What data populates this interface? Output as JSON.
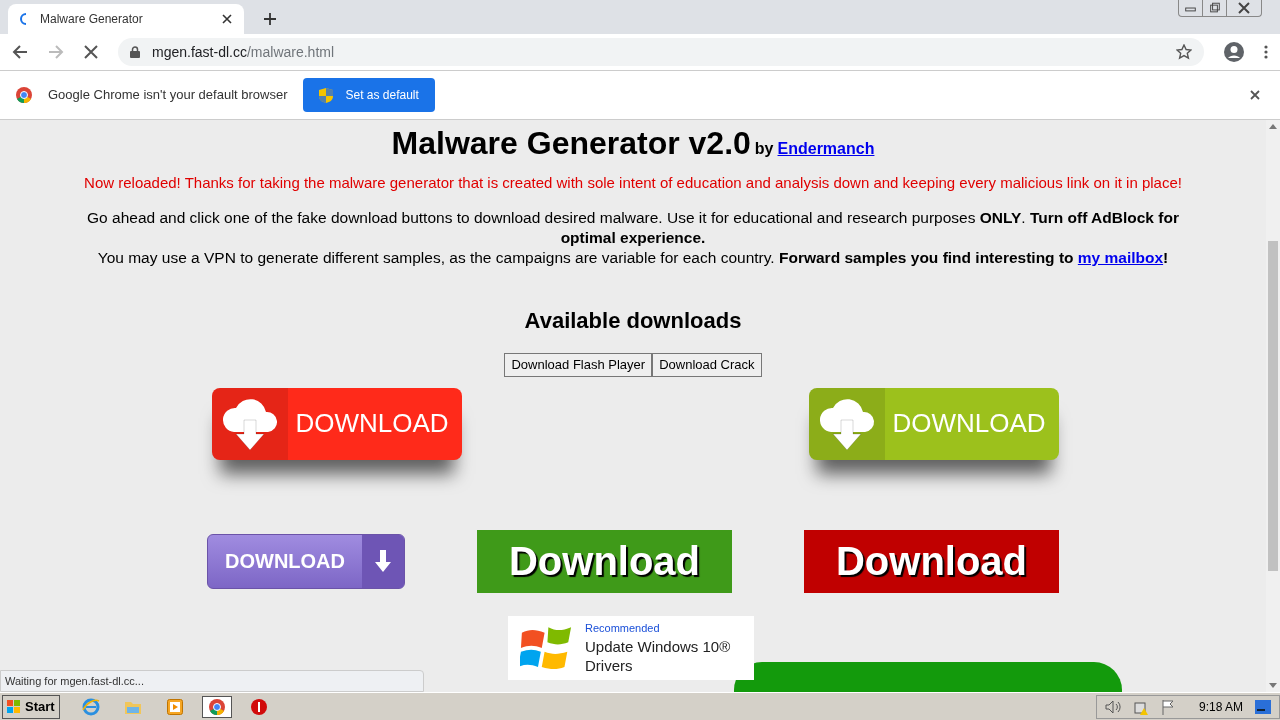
{
  "browser": {
    "tab": {
      "title": "Malware Generator",
      "selected": true
    },
    "url_host": "mgen.fast-dl.cc",
    "url_path": "/malware.html",
    "infobar": {
      "message": "Google Chrome isn't your default browser",
      "button": "Set as default"
    }
  },
  "page": {
    "title": "Malware Generator v2.0",
    "by": "by",
    "author": "Endermanch",
    "notice": "Now reloaded! Thanks for taking the malware generator that is created with sole intent of education and analysis down and keeping every malicious link on it in place!",
    "intro": "Go ahead and click one of the fake download buttons to download desired malware. Use it for educational and research purposes **ONLY**. **Turn off AdBlock for optimal experience.**",
    "vpn_before": "You may use a VPN to generate different samples, as the campaigns are variable for each country. **Forward samples you find interesting to** ",
    "vpn_link": "my mailbox",
    "vpn_after": "**!**",
    "section": "Available downloads",
    "buttons": [
      "Download Flash Player",
      "Download Crack"
    ],
    "downloads": [
      {
        "kind": "cloud",
        "color": "#ff2a1a",
        "label": "DOWNLOAD"
      },
      {
        "kind": "cloud",
        "color": "#9cc11c",
        "label": "DOWNLOAD"
      },
      {
        "kind": "purple",
        "label": "DOWNLOAD"
      },
      {
        "kind": "flat",
        "color": "#3f9a19",
        "label": "Download"
      },
      {
        "kind": "flat",
        "color": "#c00000",
        "label": "Download"
      }
    ],
    "ad": {
      "tag": "Recommended",
      "text": "Update Windows 10® Drivers"
    }
  },
  "status": "Waiting for mgen.fast-dl.cc...",
  "taskbar": {
    "start": "Start",
    "apps": [
      {
        "kind": "ie",
        "selected": false
      },
      {
        "kind": "folder",
        "selected": false
      },
      {
        "kind": "media",
        "selected": false
      },
      {
        "kind": "chrome",
        "selected": true
      },
      {
        "kind": "stop",
        "selected": false
      }
    ],
    "time": "9:18 AM"
  }
}
